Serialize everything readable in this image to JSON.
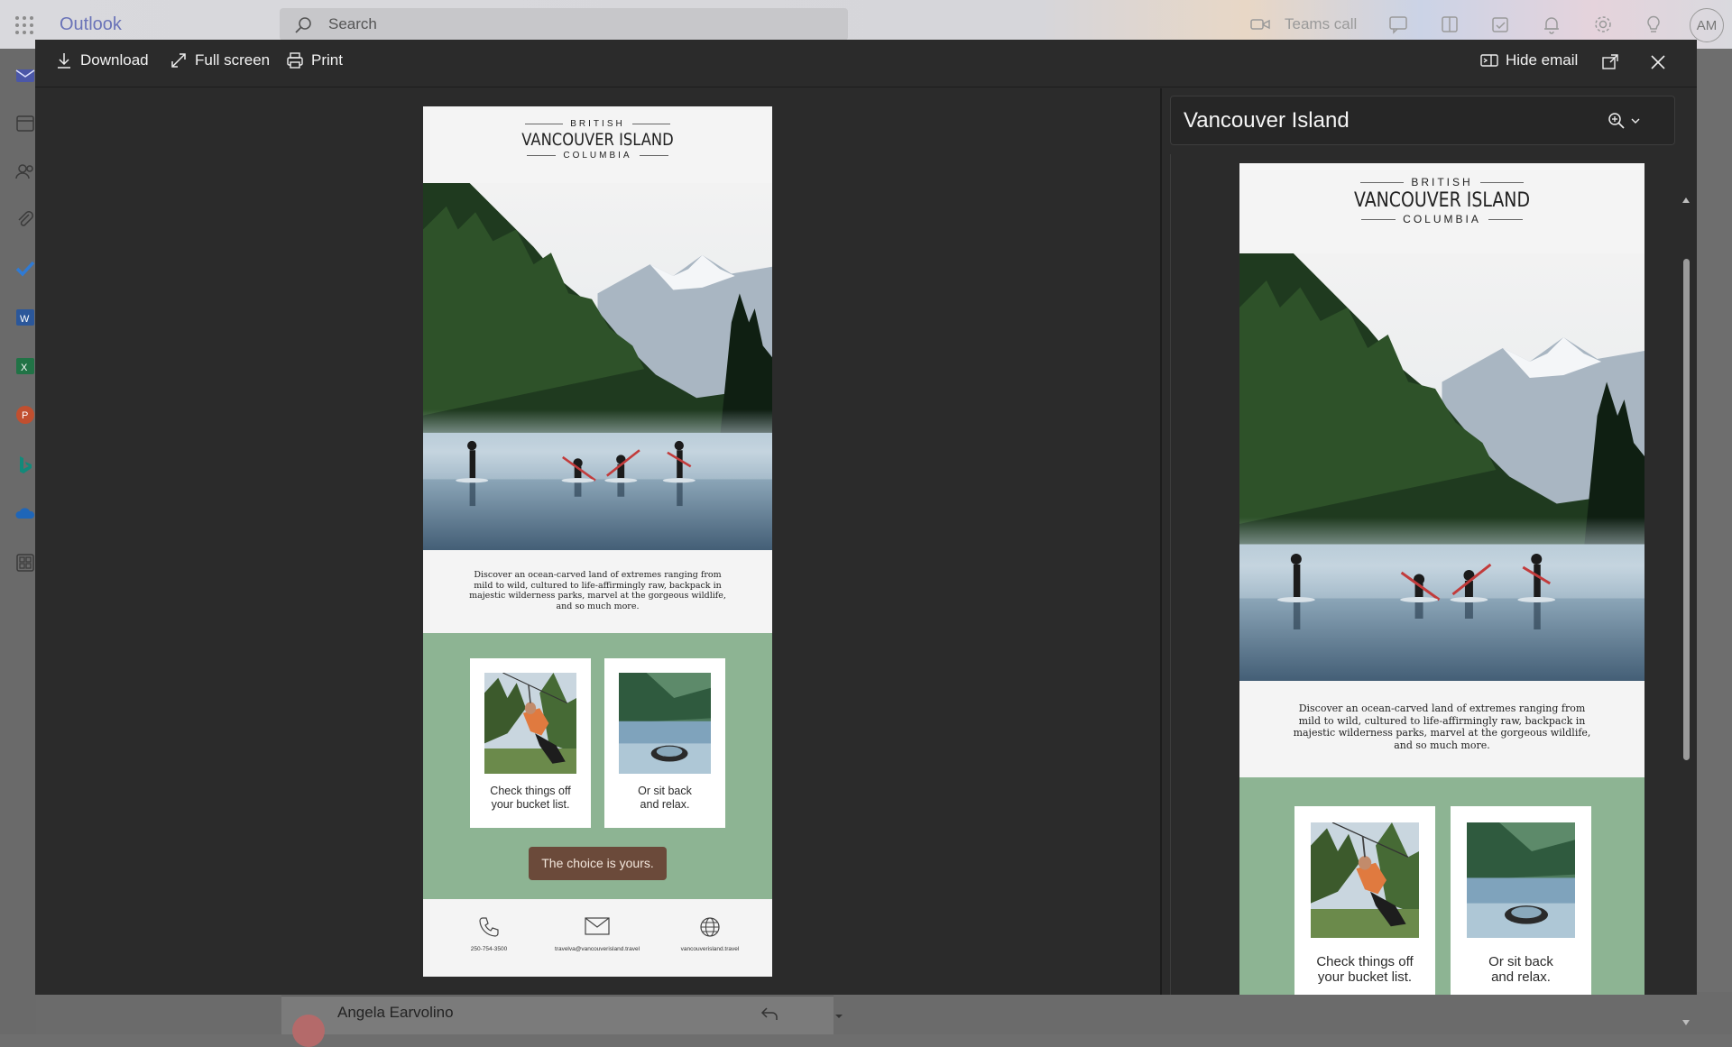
{
  "outlook": {
    "brand": "Outlook",
    "search_placeholder": "Search",
    "teams_call": "Teams call",
    "avatar_initials": "AM"
  },
  "toolbar": {
    "download": "Download",
    "full_screen": "Full screen",
    "print": "Print",
    "hide_email": "Hide email"
  },
  "email": {
    "logo_top": "BRITISH",
    "logo_main": "VANCOUVER ISLAND",
    "logo_bottom": "COLUMBIA",
    "intro_lines": [
      "Discover an ocean-carved land of extremes ranging from",
      "mild to wild, cultured to life-affirmingly raw, backpack in",
      "majestic wilderness parks, marvel at the gorgeous wildlife,",
      "and so much more."
    ],
    "tile1_lines": [
      "Check things off",
      "your bucket list."
    ],
    "tile2_lines": [
      "Or sit back",
      "and relax."
    ],
    "cta": "The choice is yours.",
    "phone": "250-754-3500",
    "email_addr": "travelva@vancouverisland.travel",
    "website": "vancouverisland.travel"
  },
  "panel": {
    "title": "Vancouver Island"
  },
  "background": {
    "sender": "Angela Earvolino"
  },
  "colors": {
    "accent": "#6a73b8",
    "green_band": "#8db493",
    "cta_bg": "#6b4a3a",
    "viewer_bg": "#2b2b2b"
  },
  "icons": [
    "download-icon",
    "full-screen-icon",
    "print-icon",
    "hide-email-icon",
    "pop-out-icon",
    "close-icon",
    "zoom-icon",
    "phone-icon",
    "mail-icon",
    "globe-icon"
  ]
}
